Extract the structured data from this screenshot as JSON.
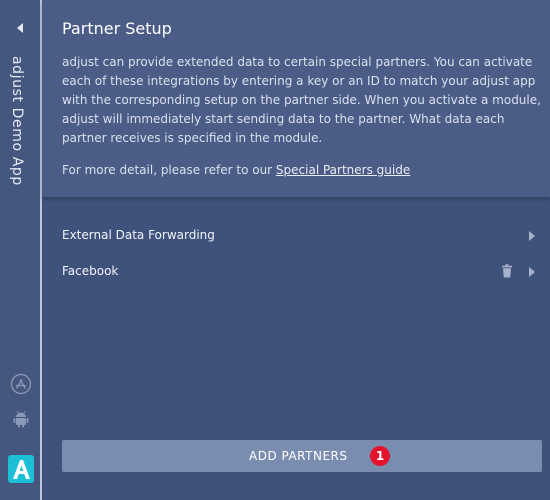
{
  "sidebar": {
    "app_name": "adjust Demo App",
    "collapse_icon": "chevron-left-icon",
    "platform_icons": [
      "app-store-icon",
      "android-icon"
    ],
    "logo_icon": "adjust-logo-icon"
  },
  "info_panel": {
    "title": "Partner Setup",
    "body": "adjust can provide extended data to certain special partners. You can activate each of these integrations by entering a key or an ID to match your adjust app with the corresponding setup on the partner side. When you activate a module, adjust will immediately start sending data to the partner. What data each partner receives is specified in the module.",
    "detail_prefix": "For more detail, please refer to our ",
    "detail_link": "Special Partners guide"
  },
  "partners": [
    {
      "label": "External Data Forwarding",
      "has_delete": false
    },
    {
      "label": "Facebook",
      "has_delete": true
    }
  ],
  "add_button": {
    "label": "ADD PARTNERS",
    "badge": "1"
  },
  "colors": {
    "background": "#3f527c",
    "panel": "#4b5c86",
    "button": "#7b8cb1",
    "badge": "#e3142c",
    "logo": "#1bc0d6"
  }
}
